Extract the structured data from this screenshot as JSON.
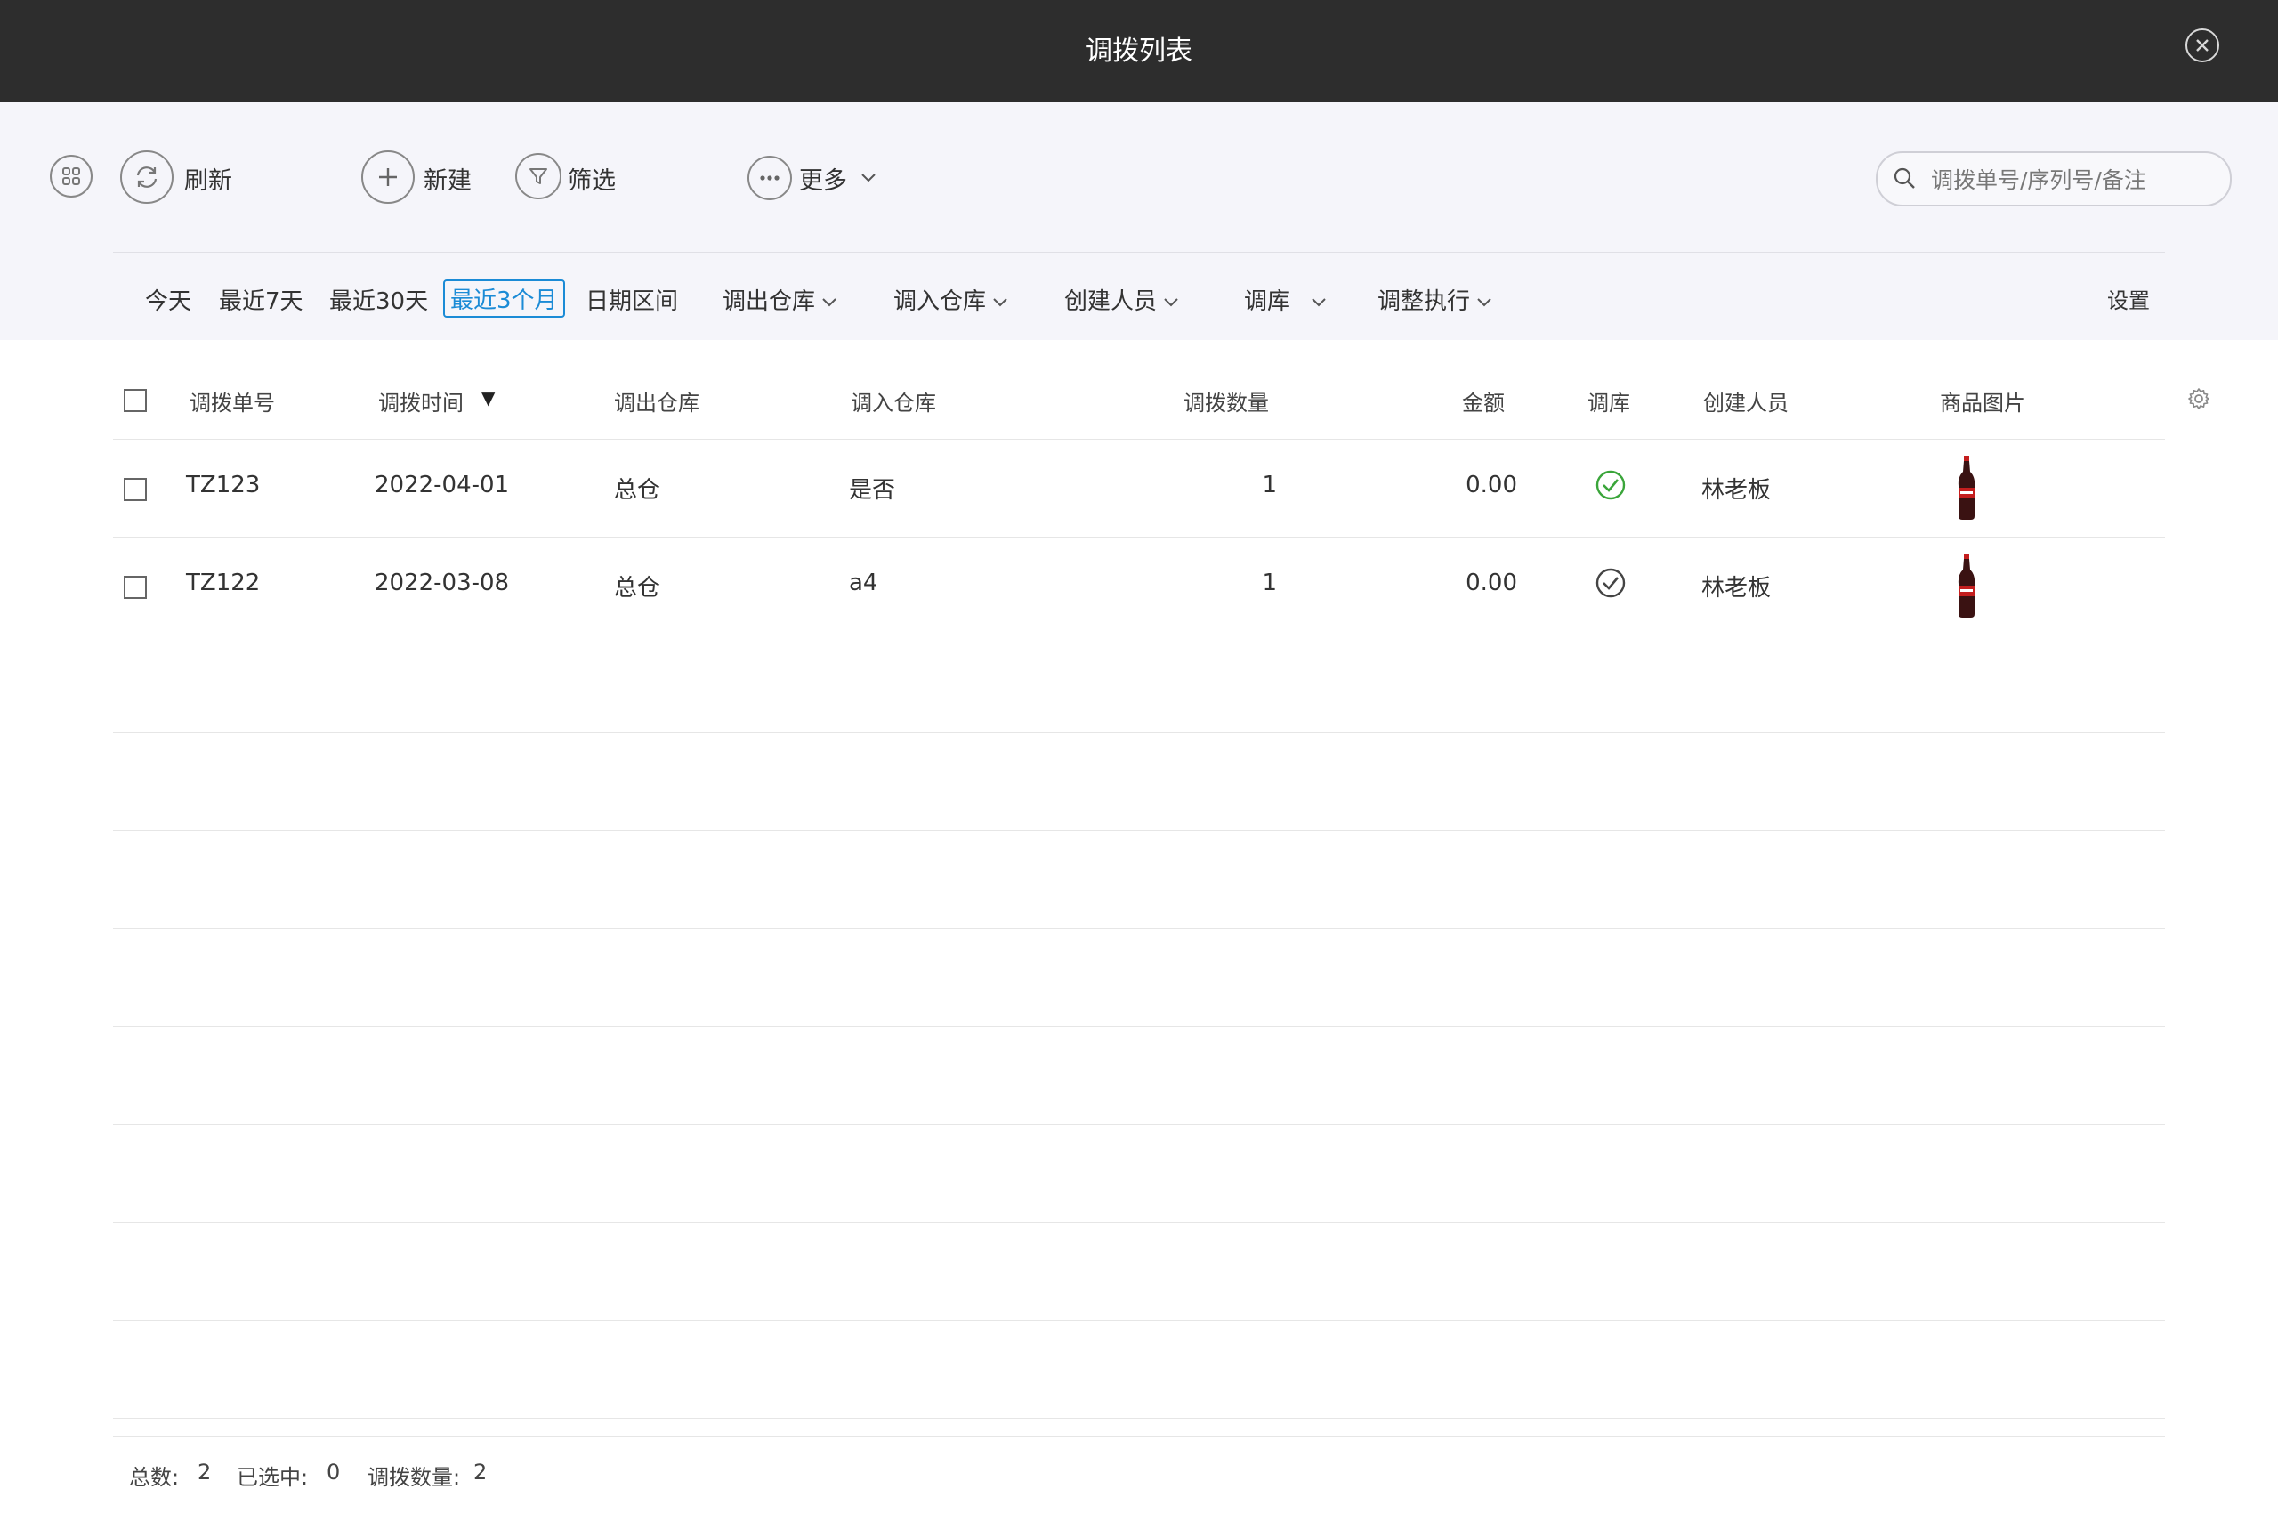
{
  "window": {
    "title": "调拨列表"
  },
  "toolbar": {
    "refresh_label": "刷新",
    "new_label": "新建",
    "filter_label": "筛选",
    "more_label": "更多"
  },
  "search": {
    "placeholder": "调拨单号/序列号/备注",
    "value": ""
  },
  "filters": {
    "today": "今天",
    "last7": "最近7天",
    "last30": "最近30天",
    "last3m": "最近3个月",
    "range": "日期区间",
    "out_wh": "调出仓库",
    "in_wh": "调入仓库",
    "creator": "创建人员",
    "transfer": "调库",
    "adjust": "调整执行",
    "settings": "设置",
    "active": "最近3个月"
  },
  "table": {
    "headers": {
      "order_no": "调拨单号",
      "time": "调拨时间",
      "out_wh": "调出仓库",
      "in_wh": "调入仓库",
      "qty": "调拨数量",
      "amount": "金额",
      "transfer": "调库",
      "creator": "创建人员",
      "image": "商品图片"
    },
    "sort_indicator": "▼",
    "rows": [
      {
        "order_no": "TZ123",
        "time": "2022-04-01",
        "out_wh": "总仓",
        "in_wh": "是否",
        "qty": "1",
        "amount": "0.00",
        "transfer_icon": "check-circle-green-icon",
        "creator": "林老板",
        "image_icon": "cola-bottle-image"
      },
      {
        "order_no": "TZ122",
        "time": "2022-03-08",
        "out_wh": "总仓",
        "in_wh": "a4",
        "qty": "1",
        "amount": "0.00",
        "transfer_icon": "check-circle-gray-icon",
        "creator": "林老板",
        "image_icon": "cola-bottle-image"
      }
    ]
  },
  "footer": {
    "total_label": "总数:",
    "total_value": "2",
    "selected_label": "已选中:",
    "selected_value": "0",
    "qty_label": "调拨数量:",
    "qty_value": "2"
  },
  "colors": {
    "titlebar_bg": "#2d2d2d",
    "toolbar_bg": "#f5f5fa",
    "accent_blue": "#1b8bd6",
    "check_green": "#3aa53a"
  }
}
